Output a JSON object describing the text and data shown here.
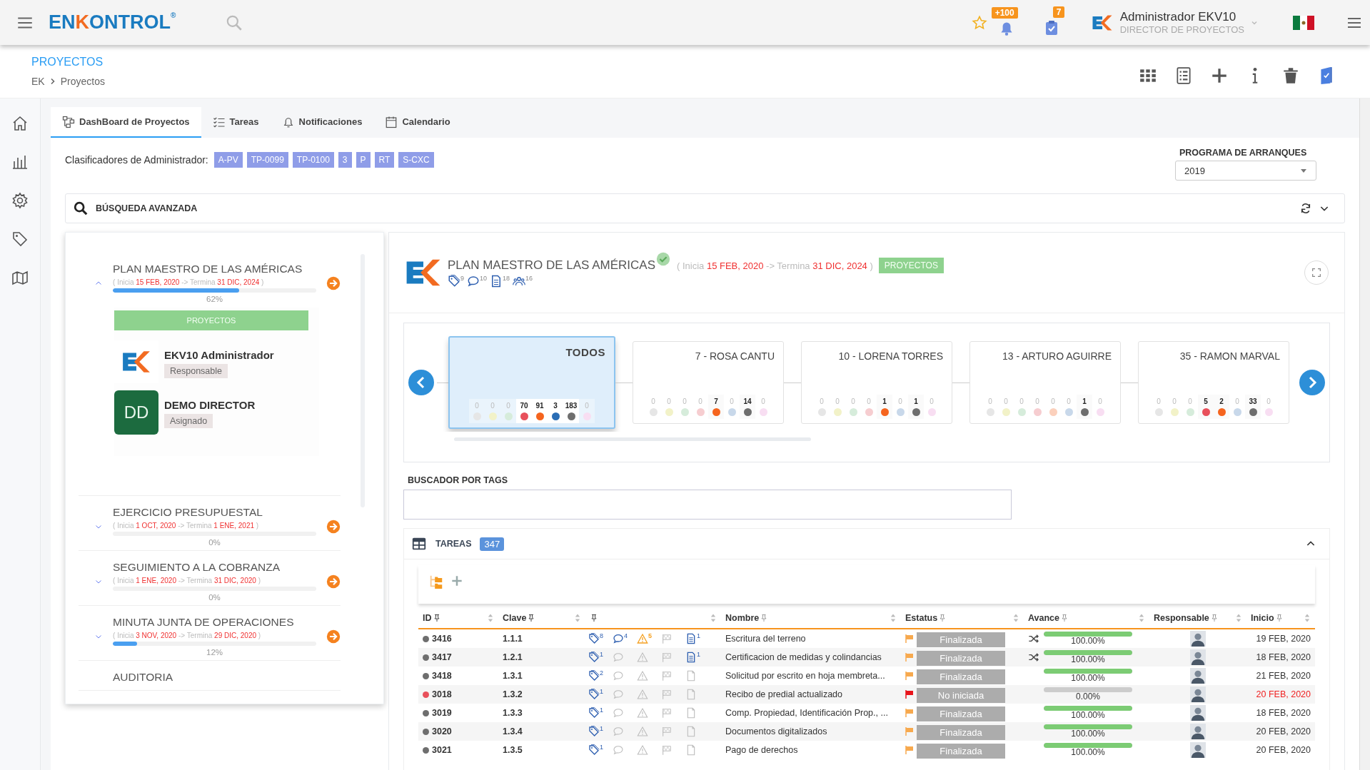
{
  "topbar": {
    "logo": [
      {
        "text": "EN",
        "accent": false
      },
      {
        "text": "K",
        "accent": true
      },
      {
        "text": "ONTROL",
        "accent": false
      },
      {
        "text": "®",
        "accent": false
      }
    ],
    "notifications_badge": "+100",
    "tasks_badge": "7",
    "user": {
      "name": "Administrador EKV10",
      "role": "DIRECTOR DE PROYECTOS"
    }
  },
  "page": {
    "title": "PROYECTOS",
    "breadcrumb": [
      "EK",
      "Proyectos"
    ]
  },
  "tabs": [
    {
      "label": "DashBoard de Proyectos",
      "selected": true
    },
    {
      "label": "Tareas",
      "selected": false
    },
    {
      "label": "Notificaciones",
      "selected": false
    },
    {
      "label": "Calendario",
      "selected": false
    }
  ],
  "classifiers": {
    "label": "Clasificadores de Administrador:",
    "tags": [
      "A-PV",
      "TP-0099",
      "TP-0100",
      "3",
      "P",
      "RT",
      "S-CXC"
    ]
  },
  "program": {
    "label": "PROGRAMA DE ARRANQUES",
    "value": "2019"
  },
  "advanced_search": {
    "label": "BÚSQUEDA AVANZADA"
  },
  "projects": [
    {
      "title": "PLAN MAESTRO DE LAS AMÉRICAS",
      "expanded": true,
      "dates": {
        "open": "(",
        "start_label": "Inicia",
        "start": "15 FEB, 2020",
        "arrow": "->",
        "end_label": "Termina",
        "end": "31 DIC, 2024",
        "close": ")"
      },
      "level": 0.62,
      "reading": "62%",
      "badge": "PROYECTOS",
      "people": [
        {
          "kind": "logo",
          "name": "EKV10 Administrador",
          "role": "Responsable"
        },
        {
          "kind": "initials",
          "initials": "DD",
          "name": "DEMO DIRECTOR",
          "role": "Asignado"
        }
      ]
    },
    {
      "title": "EJERCICIO PRESUPUESTAL",
      "expanded": false,
      "dates": {
        "open": "(",
        "start_label": "Inicia",
        "start": "1 OCT, 2020",
        "arrow": "->",
        "end_label": "Termina",
        "end": "1 ENE, 2021",
        "close": ")"
      },
      "level": 0,
      "reading": "0%"
    },
    {
      "title": "SEGUIMIENTO A LA COBRANZA",
      "expanded": false,
      "dates": {
        "open": "(",
        "start_label": "Inicia",
        "start": "1 ENE, 2020",
        "arrow": "->",
        "end_label": "Termina",
        "end": "31 DIC, 2020",
        "close": ")"
      },
      "level": 0,
      "reading": "0%"
    },
    {
      "title": "MINUTA JUNTA DE OPERACIONES",
      "expanded": false,
      "dates": {
        "open": "(",
        "start_label": "Inicia",
        "start": "3 NOV, 2020",
        "arrow": "->",
        "end_label": "Termina",
        "end": "29 DIC, 2020",
        "close": ")"
      },
      "level": 0.12,
      "reading": "12%"
    },
    {
      "title": "AUDITORIA"
    }
  ],
  "detail": {
    "title": "PLAN MAESTRO DE LAS AMÉRICAS",
    "verified": true,
    "dates": {
      "open": "(",
      "start_label": "Inicia",
      "start": "15 FEB, 2020",
      "arrow": "->",
      "end_label": "Termina",
      "end": "31 DIC, 2024",
      "close": ")"
    },
    "badge": "PROYECTOS",
    "counts": [
      {
        "kind": "tag",
        "value": "9"
      },
      {
        "kind": "comment",
        "value": "10"
      },
      {
        "kind": "document",
        "value": "18"
      },
      {
        "kind": "people",
        "value": "16"
      }
    ]
  },
  "carousel": [
    {
      "title": "TODOS",
      "selected": true,
      "counts": [
        {
          "value": "0",
          "color": "#e6e6e6",
          "active": false
        },
        {
          "value": "0",
          "color": "#f2f2c8",
          "active": false
        },
        {
          "value": "0",
          "color": "#d6ecdb",
          "active": false
        },
        {
          "value": "70",
          "color": "#e8505b",
          "active": true
        },
        {
          "value": "91",
          "color": "#f5641e",
          "active": true
        },
        {
          "value": "3",
          "color": "#2a6db5",
          "active": true
        },
        {
          "value": "183",
          "color": "#6e6e6e",
          "active": true
        },
        {
          "value": "0",
          "color": "#f8def2",
          "active": false
        }
      ]
    },
    {
      "title": "7 - ROSA CANTU",
      "selected": false,
      "counts": [
        {
          "value": "0",
          "color": "#e6e6e6",
          "active": false
        },
        {
          "value": "0",
          "color": "#f2f2c8",
          "active": false
        },
        {
          "value": "0",
          "color": "#d6ecdb",
          "active": false
        },
        {
          "value": "0",
          "color": "#f6cdd0",
          "active": false
        },
        {
          "value": "7",
          "color": "#f5641e",
          "active": true
        },
        {
          "value": "0",
          "color": "#c8d8ea",
          "active": false
        },
        {
          "value": "14",
          "color": "#6e6e6e",
          "active": true
        },
        {
          "value": "0",
          "color": "#f8def2",
          "active": false
        }
      ]
    },
    {
      "title": "10 - LORENA TORRES",
      "selected": false,
      "counts": [
        {
          "value": "0",
          "color": "#e6e6e6",
          "active": false
        },
        {
          "value": "0",
          "color": "#f2f2c8",
          "active": false
        },
        {
          "value": "0",
          "color": "#d6ecdb",
          "active": false
        },
        {
          "value": "0",
          "color": "#f6cdd0",
          "active": false
        },
        {
          "value": "1",
          "color": "#f5641e",
          "active": true
        },
        {
          "value": "0",
          "color": "#c8d8ea",
          "active": false
        },
        {
          "value": "1",
          "color": "#6e6e6e",
          "active": true
        },
        {
          "value": "0",
          "color": "#f8def2",
          "active": false
        }
      ]
    },
    {
      "title": "13 - ARTURO AGUIRRE",
      "selected": false,
      "counts": [
        {
          "value": "0",
          "color": "#e6e6e6",
          "active": false
        },
        {
          "value": "0",
          "color": "#f2f2c8",
          "active": false
        },
        {
          "value": "0",
          "color": "#d6ecdb",
          "active": false
        },
        {
          "value": "0",
          "color": "#f6cdd0",
          "active": false
        },
        {
          "value": "0",
          "color": "#fbd0bc",
          "active": false
        },
        {
          "value": "0",
          "color": "#c8d8ea",
          "active": false
        },
        {
          "value": "1",
          "color": "#6e6e6e",
          "active": true
        },
        {
          "value": "0",
          "color": "#f8def2",
          "active": false
        }
      ]
    },
    {
      "title": "35 - RAMON MARVAL",
      "selected": false,
      "counts": [
        {
          "value": "0",
          "color": "#e6e6e6",
          "active": false
        },
        {
          "value": "0",
          "color": "#f2f2c8",
          "active": false
        },
        {
          "value": "0",
          "color": "#d6ecdb",
          "active": false
        },
        {
          "value": "5",
          "color": "#e8505b",
          "active": true
        },
        {
          "value": "2",
          "color": "#f5641e",
          "active": true
        },
        {
          "value": "0",
          "color": "#c8d8ea",
          "active": false
        },
        {
          "value": "33",
          "color": "#6e6e6e",
          "active": true
        },
        {
          "value": "0",
          "color": "#f8def2",
          "active": false
        }
      ]
    }
  ],
  "tag_search": {
    "label": "BUSCADOR POR TAGS"
  },
  "tasks": {
    "title": "TAREAS",
    "count": "347",
    "expanded": true,
    "columns": [
      {
        "label": "ID",
        "pinned": true
      },
      {
        "label": "Clave",
        "pinned": true
      },
      {
        "pinned": true
      },
      {
        "label": "Nombre",
        "pinned": false
      },
      {
        "label": "Estatus",
        "pinned": false
      },
      {
        "label": "Avance",
        "pinned": false
      },
      {
        "label": "Responsable",
        "pinned": false
      },
      {
        "label": "Inicio",
        "pinned": false
      }
    ],
    "rows": [
      {
        "id": "3416",
        "color": "#6e6e6e",
        "clave": "1.1.1",
        "tags": "8",
        "comments": "4",
        "warnings": "5",
        "docs": "1",
        "name": "Escritura del terreno",
        "urgent": false,
        "status": "Finalizada",
        "linked": true,
        "level": 1,
        "reading": "100.00%",
        "start": "19 FEB, 2020",
        "overdue": false
      },
      {
        "id": "3417",
        "color": "#6e6e6e",
        "clave": "1.2.1",
        "tags": "1",
        "docs": "1",
        "name": "Certificacion de medidas y colindancias",
        "urgent": false,
        "status": "Finalizada",
        "linked": true,
        "level": 1,
        "reading": "100.00%",
        "start": "18 FEB, 2020",
        "overdue": false
      },
      {
        "id": "3418",
        "color": "#6e6e6e",
        "clave": "1.3.1",
        "tags": "2",
        "name": "Solicitud por escrito en hoja membreta...",
        "urgent": false,
        "status": "Finalizada",
        "linked": false,
        "level": 1,
        "reading": "100.00%",
        "start": "21 FEB, 2020",
        "overdue": false
      },
      {
        "id": "3018",
        "color": "#e8505b",
        "clave": "1.3.2",
        "tags": "1",
        "name": "Recibo de predial actualizado",
        "urgent": true,
        "status": "No iniciada",
        "linked": false,
        "level": 0,
        "reading": "0.00%",
        "start": "20 FEB, 2020",
        "overdue": true
      },
      {
        "id": "3019",
        "color": "#6e6e6e",
        "clave": "1.3.3",
        "tags": "1",
        "name": "Comp. Propiedad, Identificación Prop., ...",
        "urgent": false,
        "status": "Finalizada",
        "linked": false,
        "level": 1,
        "reading": "100.00%",
        "start": "18 FEB, 2020",
        "overdue": false
      },
      {
        "id": "3020",
        "color": "#6e6e6e",
        "clave": "1.3.4",
        "tags": "1",
        "name": "Documentos digitalizados",
        "urgent": false,
        "status": "Finalizada",
        "linked": false,
        "level": 1,
        "reading": "100.00%",
        "start": "20 FEB, 2020",
        "overdue": false
      },
      {
        "id": "3021",
        "color": "#6e6e6e",
        "clave": "1.3.5",
        "tags": "1",
        "name": "Pago de derechos",
        "urgent": false,
        "status": "Finalizada",
        "linked": false,
        "level": 1,
        "reading": "100.00%",
        "start": "20 FEB, 2020",
        "overdue": false
      }
    ]
  }
}
